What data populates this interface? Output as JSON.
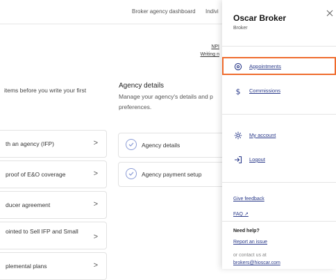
{
  "topnav": {
    "links": [
      "Broker agency dashboard",
      "Indivi"
    ]
  },
  "main": {
    "npi_label": "NPI",
    "writing_label": "Writing n",
    "intro_text": " items before you write your first",
    "left_cards": [
      "th an agency (IFP)",
      "proof of E&O coverage",
      "ducer agreement",
      "ointed to Sell IFP and Small",
      "plemental plans"
    ],
    "section_title": "Agency details",
    "section_desc": "Manage your agency's details and p preferences.",
    "right_cards": [
      "Agency details",
      "Agency payment setup"
    ],
    "chevron": ">"
  },
  "drawer": {
    "name": "Oscar Broker",
    "role": "Broker",
    "items": [
      {
        "label": "Appointments",
        "icon": "location-pin-icon",
        "active": true
      },
      {
        "label": "Commissions",
        "icon": "dollar-icon",
        "active": false
      },
      {
        "label": "My account",
        "icon": "gear-icon",
        "active": false
      },
      {
        "label": "Logout",
        "icon": "logout-icon",
        "active": false
      }
    ],
    "give_feedback": "Give feedback",
    "faq": "FAQ ↗",
    "help_title": "Need help?",
    "report_issue": "Report an issue",
    "contact_text": "or contact us at",
    "email": "brokers@hioscar.com"
  },
  "colors": {
    "accent_border": "#ef6a2b",
    "link": "#2a3a8a"
  }
}
